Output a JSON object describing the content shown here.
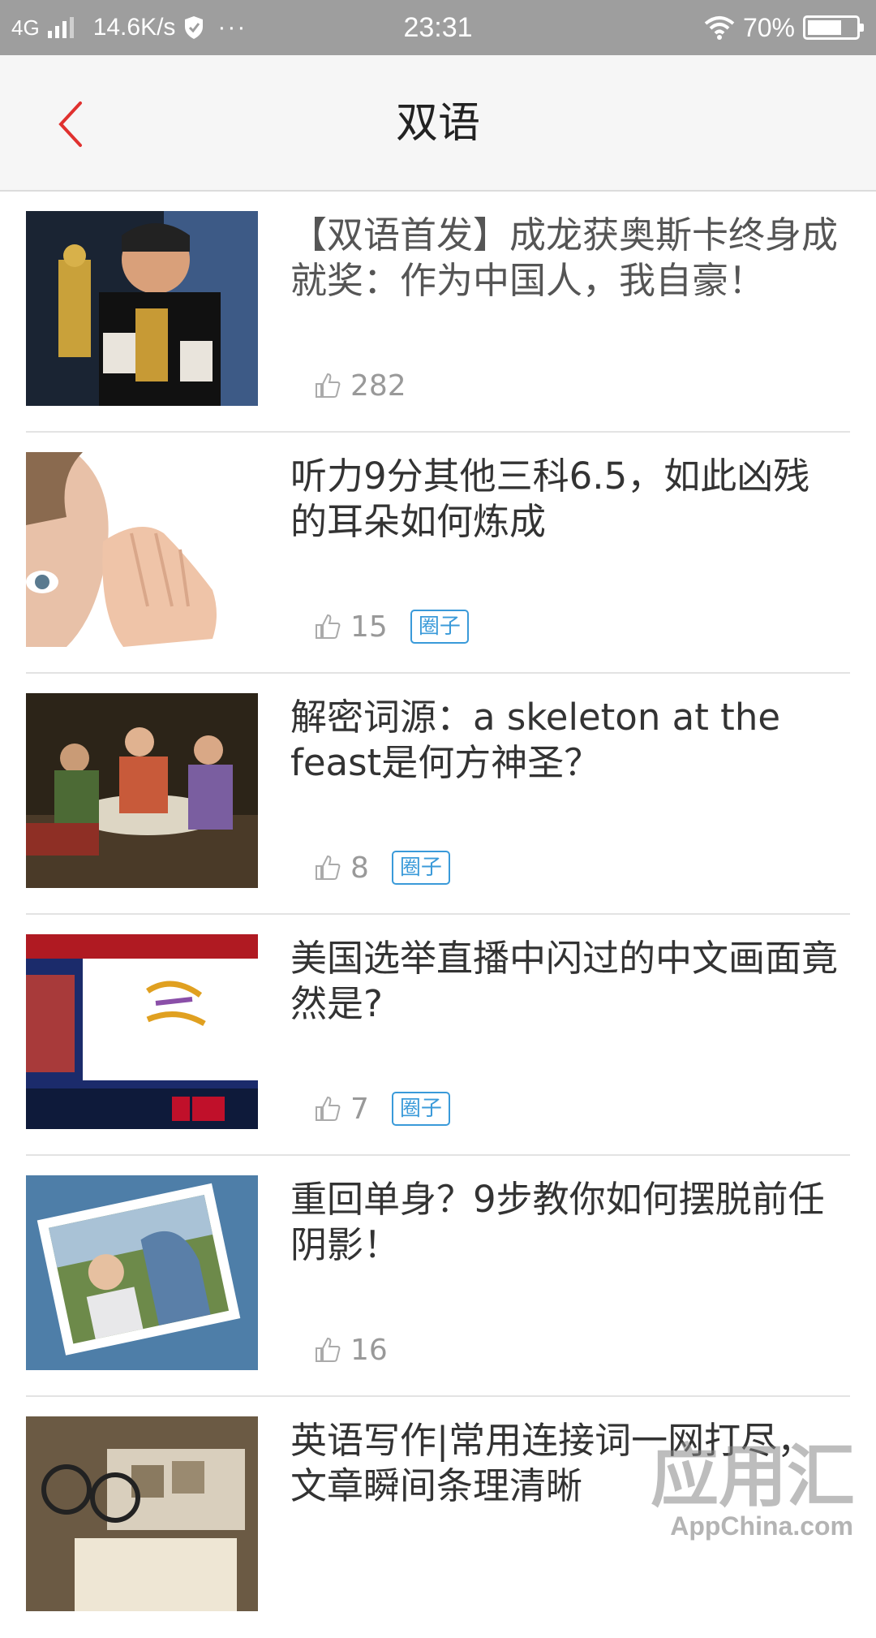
{
  "status_bar": {
    "network": "4G",
    "speed": "14.6K/s",
    "dots": "···",
    "time": "23:31",
    "battery": "70%",
    "battery_level": 0.7
  },
  "header": {
    "title": "双语"
  },
  "articles": [
    {
      "title": "【双语首发】成龙获奥斯卡终身成就奖：作为中国人，我自豪！",
      "likes": "282",
      "tag": ""
    },
    {
      "title": "听力9分其他三科6.5，如此凶残的耳朵如何炼成",
      "likes": "15",
      "tag": "圈子"
    },
    {
      "title": "解密词源：a skeleton at the feast是何方神圣？",
      "likes": "8",
      "tag": "圈子"
    },
    {
      "title": "美国选举直播中闪过的中文画面竟然是?",
      "likes": "7",
      "tag": "圈子"
    },
    {
      "title": "重回单身？9步教你如何摆脱前任阴影！",
      "likes": "16",
      "tag": ""
    },
    {
      "title": "英语写作|常用连接词一网打尽，文章瞬间条理清晰",
      "likes": "",
      "tag": ""
    }
  ],
  "watermark": {
    "text": "应用汇",
    "sub": "AppChina.com"
  },
  "colors": {
    "accent_red": "#e0312f",
    "tag_blue": "#3a9ad9"
  }
}
